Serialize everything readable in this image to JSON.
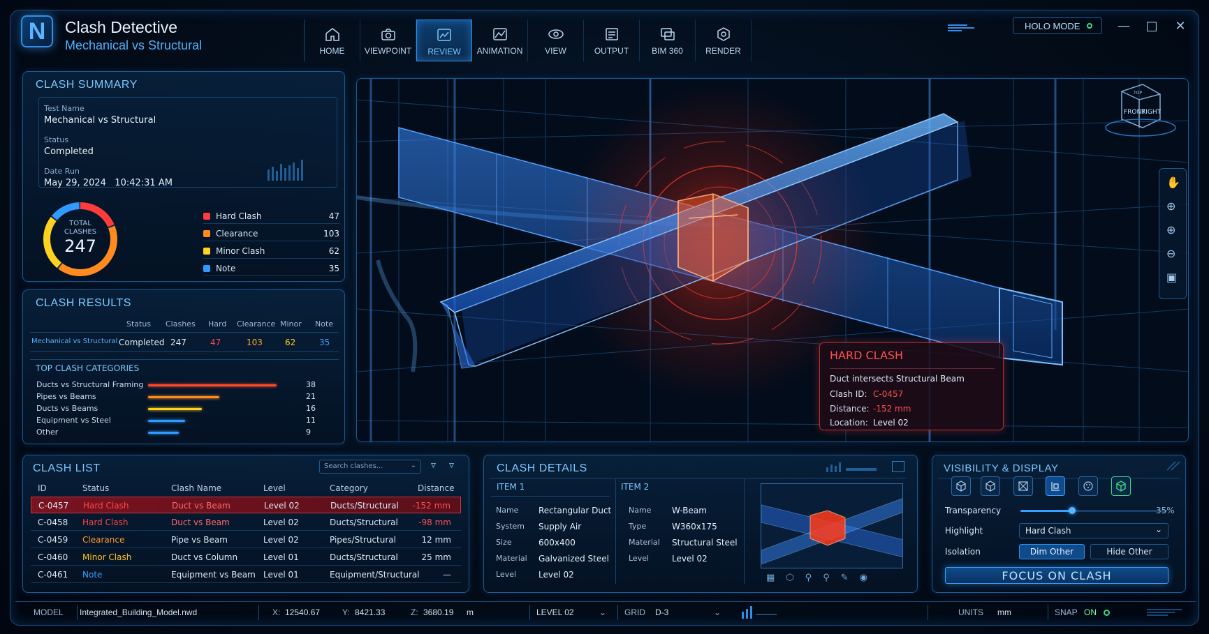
{
  "app": {
    "title": "Clash Detective",
    "subtitle": "Mechanical vs Structural",
    "logo": "N",
    "holo_label": "HOLO MODE"
  },
  "ribbon": [
    {
      "label": "HOME",
      "icon": "home-icon"
    },
    {
      "label": "VIEWPOINT",
      "icon": "camera-icon"
    },
    {
      "label": "REVIEW",
      "icon": "review-icon",
      "active": true
    },
    {
      "label": "ANIMATION",
      "icon": "animation-icon"
    },
    {
      "label": "VIEW",
      "icon": "eye-icon"
    },
    {
      "label": "OUTPUT",
      "icon": "output-icon"
    },
    {
      "label": "BIM 360",
      "icon": "bim360-icon"
    },
    {
      "label": "RENDER",
      "icon": "render-icon"
    }
  ],
  "summary": {
    "title": "CLASH SUMMARY",
    "test_name_label": "Test Name",
    "test_name": "Mechanical vs Structural",
    "status_label": "Status",
    "status": "Completed",
    "date_label": "Date Run",
    "date": "May 29, 2024   10:42:31 AM",
    "total_label_1": "TOTAL",
    "total_label_2": "CLASHES",
    "total": "247",
    "legend": [
      {
        "name": "Hard Clash",
        "count": 47,
        "color": "#ff3b3b"
      },
      {
        "name": "Clearance",
        "count": 103,
        "color": "#ff8a1f"
      },
      {
        "name": "Minor Clash",
        "count": 62,
        "color": "#ffd21f"
      },
      {
        "name": "Note",
        "count": 35,
        "color": "#2f9bff"
      }
    ]
  },
  "results": {
    "title": "CLASH RESULTS",
    "headers": [
      "Status",
      "Clashes",
      "Hard",
      "Clearance",
      "Minor",
      "Note"
    ],
    "row": {
      "name": "Mechanical vs Structural",
      "status": "Completed",
      "clashes": "247",
      "hard": "47",
      "clearance": "103",
      "minor": "62",
      "note": "35"
    },
    "categories_title": "TOP CLASH CATEGORIES",
    "categories": [
      {
        "name": "Ducts vs Structural Framing",
        "value": 38,
        "color": "#ff4a2a"
      },
      {
        "name": "Pipes vs Beams",
        "value": 21,
        "color": "#ff8a1f"
      },
      {
        "name": "Ducts vs Beams",
        "value": 16,
        "color": "#ffd21f"
      },
      {
        "name": "Equipment vs Steel",
        "value": 11,
        "color": "#2f9bff"
      },
      {
        "name": "Other",
        "value": 9,
        "color": "#2f9bff"
      }
    ]
  },
  "viewport": {
    "popup_title": "HARD CLASH",
    "popup_desc": "Duct intersects Structural Beam",
    "clash_id_label": "Clash ID:",
    "clash_id": "C-0457",
    "distance_label": "Distance:",
    "distance": "-152 mm",
    "location_label": "Location:",
    "location": "Level 02",
    "cube_top": "TOP",
    "cube_front": "FRONT",
    "cube_right": "RIGHT"
  },
  "clash_list": {
    "title": "CLASH LIST",
    "search_placeholder": "Search clashes...",
    "headers": [
      "ID",
      "Status",
      "Clash Name",
      "Level",
      "Category",
      "Distance"
    ],
    "rows": [
      {
        "id": "C-0457",
        "status": "Hard Clash",
        "name": "Duct vs Beam",
        "level": "Level 02",
        "category": "Ducts/Structural",
        "distance": "-152 mm",
        "color": "#ff4545"
      },
      {
        "id": "C-0458",
        "status": "Hard Clash",
        "name": "Duct vs Beam",
        "level": "Level 02",
        "category": "Ducts/Structural",
        "distance": "-98 mm",
        "color": "#ff4545"
      },
      {
        "id": "C-0459",
        "status": "Clearance",
        "name": "Pipe vs Beam",
        "level": "Level 02",
        "category": "Pipes/Structural",
        "distance": "12 mm",
        "color": "#ff9a2a"
      },
      {
        "id": "C-0460",
        "status": "Minor Clash",
        "name": "Duct vs Column",
        "level": "Level 01",
        "category": "Ducts/Structural",
        "distance": "25 mm",
        "color": "#ffc21f"
      },
      {
        "id": "C-0461",
        "status": "Note",
        "name": "Equipment vs Beam",
        "level": "Level 01",
        "category": "Equipment/Structural",
        "distance": "—",
        "color": "#3aa0ff"
      }
    ]
  },
  "details": {
    "title": "CLASH DETAILS",
    "item1_title": "ITEM 1",
    "item2_title": "ITEM 2",
    "item1": [
      {
        "label": "Name",
        "value": "Rectangular Duct"
      },
      {
        "label": "System",
        "value": "Supply Air"
      },
      {
        "label": "Size",
        "value": "600x400"
      },
      {
        "label": "Material",
        "value": "Galvanized Steel"
      },
      {
        "label": "Level",
        "value": "Level 02"
      }
    ],
    "item2": [
      {
        "label": "Name",
        "value": "W-Beam"
      },
      {
        "label": "Type",
        "value": "W360x175"
      },
      {
        "label": "Material",
        "value": "Structural Steel"
      },
      {
        "label": "Level",
        "value": "Level 02"
      }
    ]
  },
  "visibility": {
    "title": "VISIBILITY & DISPLAY",
    "transparency_label": "Transparency",
    "transparency_value": "35%",
    "transparency_fraction": 0.35,
    "highlight_label": "Highlight",
    "highlight_value": "Hard Clash",
    "isolation_label": "Isolation",
    "dim_other": "Dim Other",
    "hide_other": "Hide Other",
    "focus_button": "FOCUS ON CLASH"
  },
  "status_bar": {
    "model_label": "MODEL",
    "model": "Integrated_Building_Model.nwd",
    "x_label": "X:",
    "x": "12540.67",
    "y_label": "Y:",
    "y": "8421.33",
    "z_label": "Z:",
    "z": "3680.19",
    "unit": "m",
    "level": "LEVEL 02",
    "grid_label": "GRID",
    "grid": "D-3",
    "units_label": "UNITS",
    "units": "mm",
    "snap_label": "SNAP",
    "snap": "ON"
  }
}
